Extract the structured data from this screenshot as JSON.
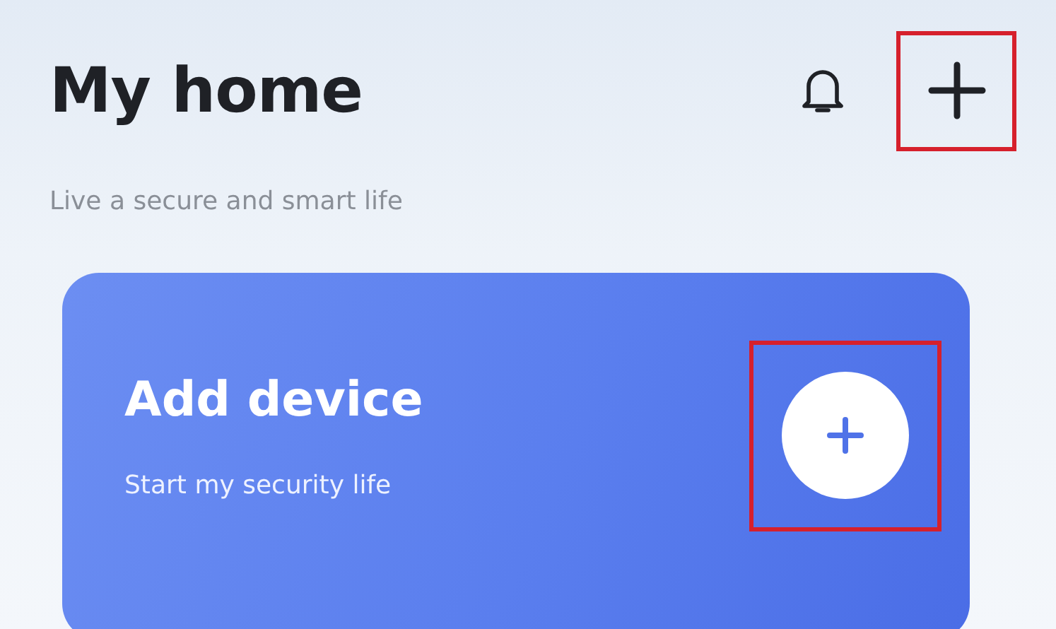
{
  "header": {
    "title": "My home",
    "subtitle": "Live a secure and smart life",
    "add_button": {
      "highlighted": true
    }
  },
  "card": {
    "title": "Add device",
    "subtitle": "Start my security life",
    "add_button": {
      "highlighted": true
    }
  }
}
